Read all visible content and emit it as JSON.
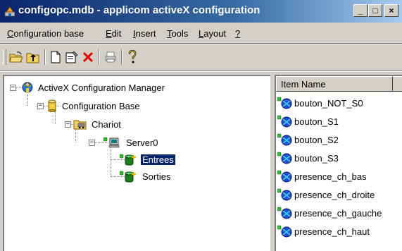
{
  "window": {
    "title": "configopc.mdb - applicom activeX configuration",
    "controls": {
      "minimize": "_",
      "maximize": "□",
      "close": "×"
    }
  },
  "menu": [
    {
      "label": "Configuration base",
      "accel": "C"
    },
    {
      "label": "Edit",
      "accel": "E"
    },
    {
      "label": "Insert",
      "accel": "I"
    },
    {
      "label": "Tools",
      "accel": "T"
    },
    {
      "label": "Layout",
      "accel": "L"
    },
    {
      "label": "?",
      "accel": "?"
    }
  ],
  "toolbar": {
    "buttons": [
      "open-folder-icon",
      "up-folder-icon",
      "new-document-icon",
      "properties-icon",
      "delete-icon",
      "print-icon",
      "help-icon"
    ]
  },
  "tree": {
    "nodes": [
      {
        "label": "ActiveX Configuration Manager",
        "icon": "globe-person-icon",
        "expanded": true,
        "selected": false
      },
      {
        "label": "Configuration Base",
        "icon": "database-icon",
        "expanded": true,
        "selected": false
      },
      {
        "label": "Chariot",
        "icon": "folder-icon",
        "expanded": true,
        "selected": false
      },
      {
        "label": "Server0",
        "icon": "server-icon",
        "expanded": true,
        "selected": false
      },
      {
        "label": "Entrees",
        "icon": "group-icon",
        "expanded": false,
        "selected": true
      },
      {
        "label": "Sorties",
        "icon": "group-icon",
        "expanded": false,
        "selected": false
      }
    ]
  },
  "list": {
    "column_header": "Item Name",
    "items": [
      "bouton_NOT_S0",
      "bouton_S1",
      "bouton_S2",
      "bouton_S3",
      "presence_ch_bas",
      "presence_ch_droite",
      "presence_ch_gauche",
      "presence_ch_haut"
    ]
  },
  "colors": {
    "titlebar_start": "#0a246a",
    "titlebar_end": "#a6caf0",
    "selection": "#0a246a",
    "face": "#d4d0c8"
  }
}
